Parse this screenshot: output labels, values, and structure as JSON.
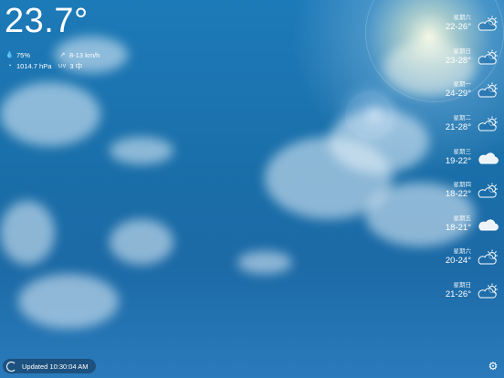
{
  "current": {
    "temperature": "23.7°",
    "humidity": "75%",
    "wind": "8-13 km/h",
    "pressure": "1014.7 hPa",
    "uv": "3 中",
    "uv_label": "UV"
  },
  "forecast": [
    {
      "day": "星期六",
      "range": "22-26°",
      "icon": "partly-cloudy-sun-icon"
    },
    {
      "day": "星期日",
      "range": "23-28°",
      "icon": "partly-cloudy-sun-icon"
    },
    {
      "day": "星期一",
      "range": "24-29°",
      "icon": "partly-cloudy-sun-icon"
    },
    {
      "day": "星期二",
      "range": "21-28°",
      "icon": "partly-cloudy-sun-icon"
    },
    {
      "day": "星期三",
      "range": "19-22°",
      "icon": "cloud-icon"
    },
    {
      "day": "星期四",
      "range": "18-22°",
      "icon": "partly-cloudy-sun-icon"
    },
    {
      "day": "星期五",
      "range": "18-21°",
      "icon": "cloud-icon"
    },
    {
      "day": "星期六",
      "range": "20-24°",
      "icon": "partly-cloudy-sun-icon"
    },
    {
      "day": "星期日",
      "range": "21-26°",
      "icon": "partly-cloudy-sun-icon"
    }
  ],
  "footer": {
    "updated": "Updated 10:30:04 AM"
  }
}
